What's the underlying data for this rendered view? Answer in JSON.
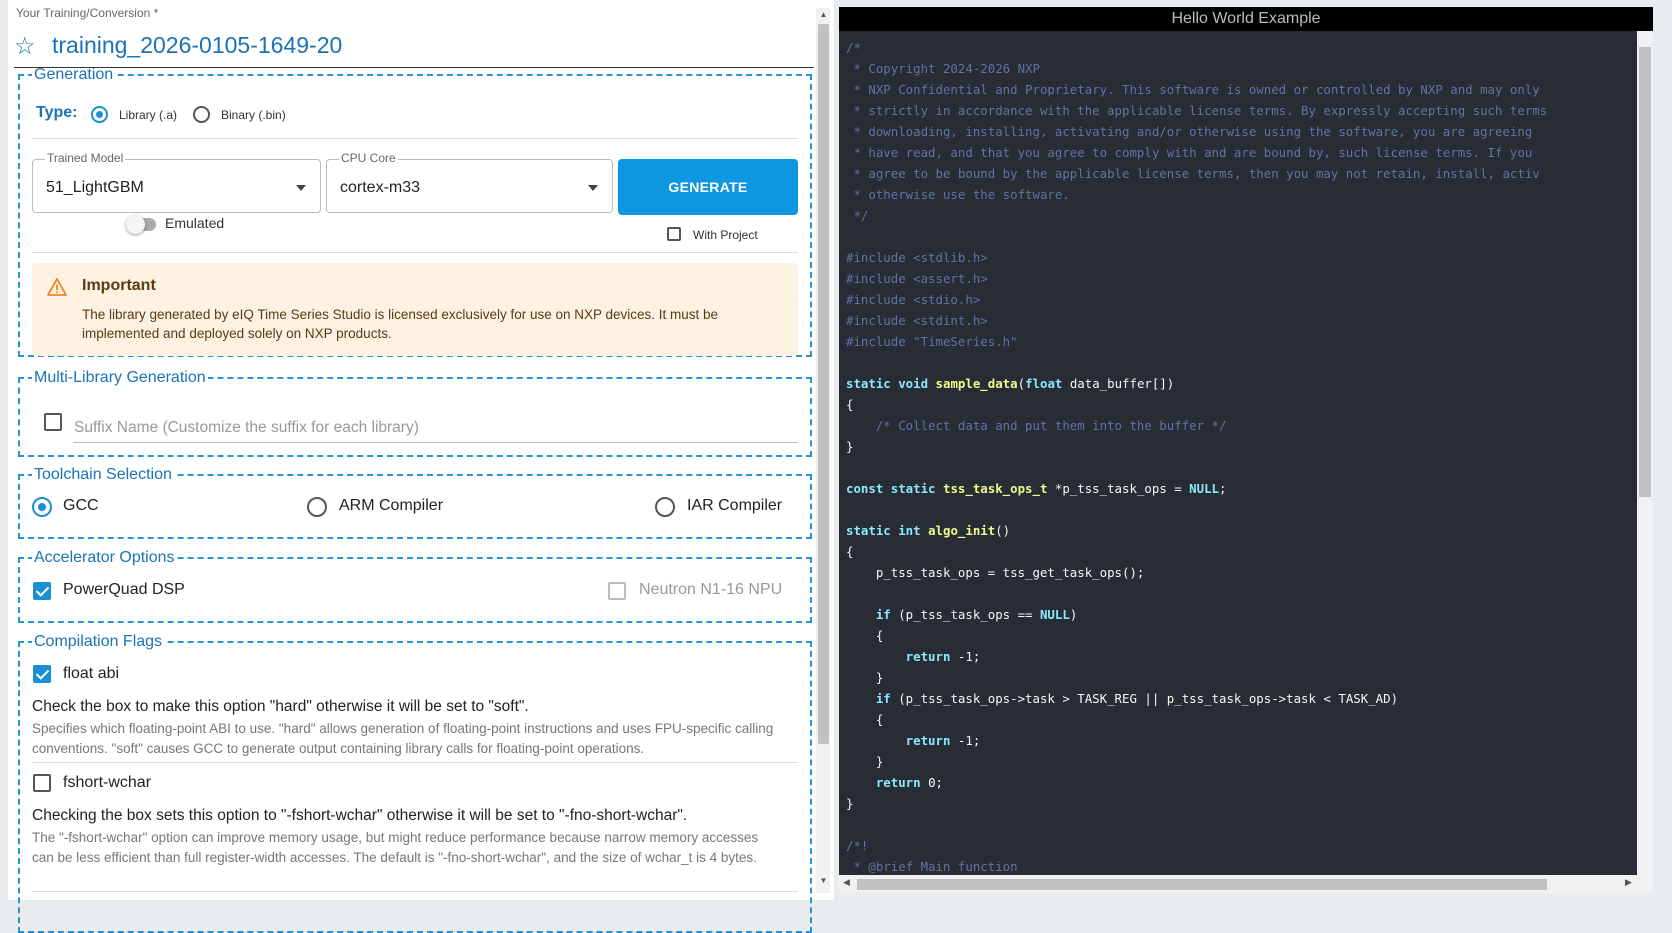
{
  "header": {
    "label": "Your Training/Conversion *",
    "title": "training_2026-0105-1649-20"
  },
  "generation": {
    "legend": "Generation",
    "type_label": "Type:",
    "type_options": [
      "Library (.a)",
      "Binary (.bin)"
    ],
    "type_selected": "Library (.a)",
    "trained_model_label": "Trained Model",
    "trained_model_value": "51_LightGBM",
    "cpu_core_label": "CPU Core",
    "cpu_core_value": "cortex-m33",
    "generate_label": "GENERATE",
    "emulated_label": "Emulated",
    "with_project_label": "With Project",
    "alert_title": "Important",
    "alert_body": "The library generated by eIQ Time Series Studio is licensed exclusively for use on NXP devices. It must be implemented and deployed solely on NXP products."
  },
  "multi_library": {
    "legend": "Multi-Library Generation",
    "suffix_placeholder": "Suffix Name (Customize the suffix for each library)"
  },
  "toolchain": {
    "legend": "Toolchain Selection",
    "options": [
      "GCC",
      "ARM Compiler",
      "IAR Compiler"
    ],
    "selected": "GCC"
  },
  "accelerator": {
    "legend": "Accelerator Options",
    "powerquad": "PowerQuad DSP",
    "neutron": "Neutron N1-16 NPU"
  },
  "flags": {
    "legend": "Compilation Flags",
    "float_abi": {
      "label": "float abi",
      "main": "Check the box to make this option \"hard\" otherwise it will be set to \"soft\".",
      "sub": "Specifies which floating-point ABI to use. \"hard\" allows generation of floating-point instructions and uses FPU-specific calling conventions. \"soft\" causes GCC to generate output containing library calls for floating-point operations."
    },
    "fshort_wchar": {
      "label": "fshort-wchar",
      "main": "Checking the box sets this option to \"-fshort-wchar\" otherwise it will be set to \"-fno-short-wchar\".",
      "sub": "The \"-fshort-wchar\" option can improve memory usage, but might reduce performance because narrow memory accesses can be less efficient than full register-width accesses. The default is \"-fno-short-wchar\", and the size of wchar_t is 4 bytes."
    }
  },
  "code_panel": {
    "title": "Hello World Example",
    "lines": [
      [
        [
          "cm",
          "/*"
        ]
      ],
      [
        [
          "cm",
          " * Copyright 2024-2026 NXP"
        ]
      ],
      [
        [
          "cm",
          " * NXP Confidential and Proprietary. This software is owned or controlled by NXP and may only"
        ]
      ],
      [
        [
          "cm",
          " * strictly in accordance with the applicable license terms. By expressly accepting such terms"
        ]
      ],
      [
        [
          "cm",
          " * downloading, installing, activating and/or otherwise using the software, you are agreeing"
        ]
      ],
      [
        [
          "cm",
          " * have read, and that you agree to comply with and are bound by, such license terms. If you"
        ]
      ],
      [
        [
          "cm",
          " * agree to be bound by the applicable license terms, then you may not retain, install, activ"
        ]
      ],
      [
        [
          "cm",
          " * otherwise use the software."
        ]
      ],
      [
        [
          "cm",
          " */"
        ]
      ],
      [],
      [
        [
          "cm",
          "#include <stdlib.h>"
        ]
      ],
      [
        [
          "cm",
          "#include <assert.h>"
        ]
      ],
      [
        [
          "cm",
          "#include <stdio.h>"
        ]
      ],
      [
        [
          "cm",
          "#include <stdint.h>"
        ]
      ],
      [
        [
          "cm",
          "#include \"TimeSeries.h\""
        ]
      ],
      [],
      [
        [
          "kw",
          "static void "
        ],
        [
          "fn",
          "sample_data"
        ],
        [
          "id",
          "("
        ],
        [
          "kw",
          "float"
        ],
        [
          "id",
          " data_buffer[])"
        ]
      ],
      [
        [
          "id",
          "{"
        ]
      ],
      [
        [
          "cm",
          "    /* Collect data and put them into the buffer */"
        ]
      ],
      [
        [
          "id",
          "}"
        ]
      ],
      [],
      [
        [
          "kw",
          "const static "
        ],
        [
          "fn",
          "tss_task_ops_t"
        ],
        [
          "id",
          " *p_tss_task_ops = "
        ],
        [
          "kw",
          "NULL"
        ],
        [
          "id",
          ";"
        ]
      ],
      [],
      [
        [
          "kw",
          "static int "
        ],
        [
          "fn",
          "algo_init"
        ],
        [
          "id",
          "()"
        ]
      ],
      [
        [
          "id",
          "{"
        ]
      ],
      [
        [
          "id",
          "    p_tss_task_ops = tss_get_task_ops();"
        ]
      ],
      [],
      [
        [
          "kw",
          "    if"
        ],
        [
          "id",
          " (p_tss_task_ops == "
        ],
        [
          "kw",
          "NULL"
        ],
        [
          "id",
          ")"
        ]
      ],
      [
        [
          "id",
          "    {"
        ]
      ],
      [
        [
          "kw",
          "        return"
        ],
        [
          "id",
          " -1;"
        ]
      ],
      [
        [
          "id",
          "    }"
        ]
      ],
      [
        [
          "kw",
          "    if"
        ],
        [
          "id",
          " (p_tss_task_ops->task > TASK_REG || p_tss_task_ops->task < TASK_AD)"
        ]
      ],
      [
        [
          "id",
          "    {"
        ]
      ],
      [
        [
          "kw",
          "        return"
        ],
        [
          "id",
          " -1;"
        ]
      ],
      [
        [
          "id",
          "    }"
        ]
      ],
      [
        [
          "kw",
          "    return"
        ],
        [
          "id",
          " 0;"
        ]
      ],
      [
        [
          "id",
          "}"
        ]
      ],
      [],
      [
        [
          "cm",
          "/*!"
        ]
      ],
      [
        [
          "cm",
          " * @brief Main function"
        ]
      ]
    ]
  },
  "colors": {
    "accent": "#1a8fd6",
    "primary_button": "#0d96e1",
    "code_bg": "#282c34",
    "comment": "#6272a4",
    "keyword": "#8be9fd",
    "function": "#f1fa8c"
  }
}
